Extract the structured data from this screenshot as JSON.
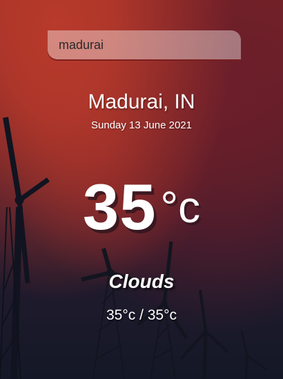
{
  "search": {
    "value": "madurai"
  },
  "location": {
    "name": "Madurai, IN",
    "date": "Sunday 13 June 2021"
  },
  "weather": {
    "temp": "35",
    "unit": "°c",
    "condition": "Clouds",
    "hilo": "35°c / 35°c"
  },
  "colors": {
    "sky_top": "#7d2224",
    "sky_bottom": "#141826",
    "text": "#ffffff"
  }
}
